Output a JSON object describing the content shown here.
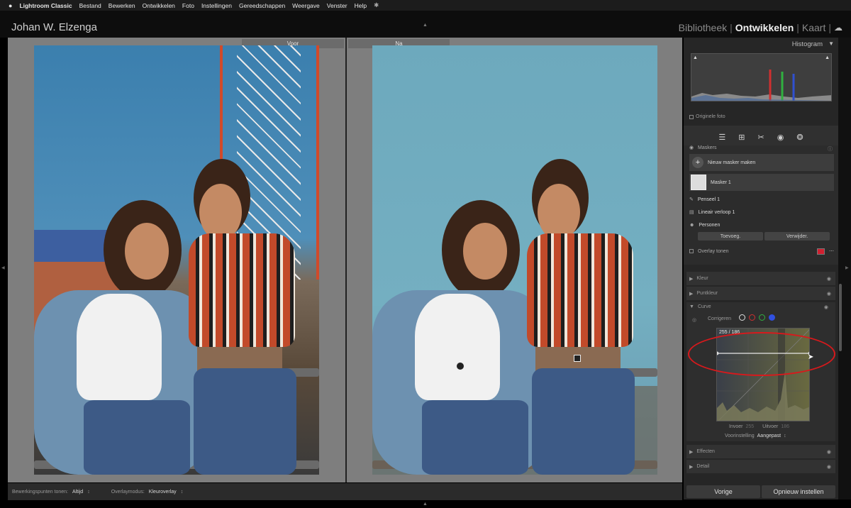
{
  "menubar": {
    "apple": "",
    "items": [
      "Lightroom Classic",
      "Bestand",
      "Bewerken",
      "Ontwikkelen",
      "Foto",
      "Instellingen",
      "Gereedschappen",
      "Weergave",
      "Venster",
      "Help"
    ]
  },
  "identity": {
    "name": "Johan W. Elzenga"
  },
  "modules": {
    "library": "Bibliotheek",
    "develop": "Ontwikkelen",
    "map": "Kaart"
  },
  "view": {
    "before_label": "Voor",
    "after_label": "Na"
  },
  "bottombar": {
    "pins_label": "Bewerkingspunten tonen:",
    "pins_value": "Altijd",
    "overlay_label": "Overlaymodus:",
    "overlay_value": "Kleuroverlay"
  },
  "histogram": {
    "title": "Histogram",
    "original_label": "Originele foto"
  },
  "masks": {
    "title": "Maskers",
    "new_mask": "Nieuw masker maken",
    "mask_name": "Masker 1",
    "components": [
      "Penseel 1",
      "Lineair verloop 1",
      "Personen"
    ],
    "add_label": "Toevoeg.",
    "subtract_label": "Verwijder.",
    "overlay_label": "Overlay tonen",
    "overlay_color": "#d02030"
  },
  "sections": {
    "kleur": "Kleur",
    "puntkleur": "Puntkleur",
    "curve": "Curve",
    "effecten": "Effecten",
    "detail": "Detail"
  },
  "curve": {
    "adjust_label": "Corrigeren",
    "readout": "255 / 186",
    "input_label": "Invoer",
    "input_value": "255",
    "output_label": "Uitvoer",
    "output_value": "186",
    "preset_label": "Voorinstelling",
    "preset_value": "Aangepast"
  },
  "footer": {
    "previous": "Vorige",
    "reset": "Opnieuw instellen"
  }
}
